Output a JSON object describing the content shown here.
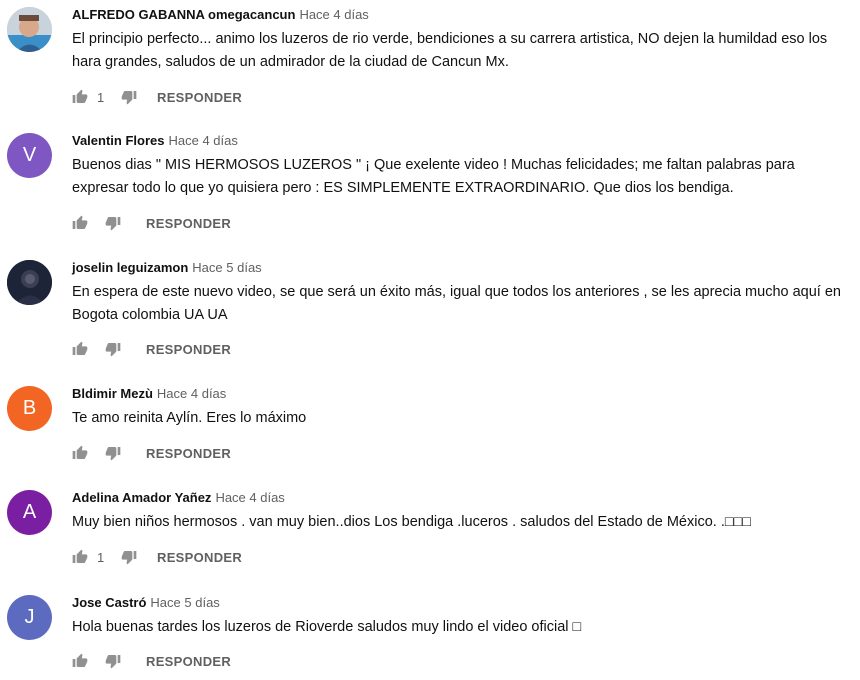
{
  "reply_label": "RESPONDER",
  "comments": [
    {
      "author": "ALFREDO GABANNA omegacancun",
      "time": "Hace 4 días",
      "text": "El principio perfecto... animo los luzeros de rio verde, bendiciones a su carrera artistica, NO dejen la humildad eso los hara grandes, saludos de un admirador de la ciudad de Cancun Mx.",
      "likes": "1",
      "avatar": {
        "type": "photo",
        "letter": ""
      }
    },
    {
      "author": "Valentin Flores",
      "time": "Hace 4 días",
      "text": "Buenos dias \" MIS HERMOSOS LUZEROS \"  ¡ Que exelente video ! Muchas felicidades; me faltan palabras para expresar todo lo que yo quisiera pero :  ES SIMPLEMENTE EXTRAORDINARIO.  Que dios los bendiga.",
      "likes": "",
      "avatar": {
        "type": "letter",
        "letter": "V",
        "color": "#7e57c2"
      }
    },
    {
      "author": "joselin leguizamon",
      "time": "Hace 5 días",
      "text": "En espera de este nuevo video, se que será un éxito más, igual que todos los anteriores , se les aprecia mucho aquí en Bogota colombia UA UA",
      "likes": "",
      "avatar": {
        "type": "photo-dark",
        "letter": ""
      }
    },
    {
      "author": "Bldimir Mezù",
      "time": "Hace 4 días",
      "text": "Te amo reinita Aylín. Eres lo máximo",
      "likes": "",
      "avatar": {
        "type": "letter",
        "letter": "B",
        "color": "#f26522"
      }
    },
    {
      "author": "Adelina Amador Yañez",
      "time": "Hace 4 días",
      "text": "Muy bien niños hermosos . van muy bien..dios Los bendiga .luceros . saludos del Estado de México. .□□□",
      "likes": "1",
      "avatar": {
        "type": "letter",
        "letter": "A",
        "color": "#7b1fa2"
      }
    },
    {
      "author": "Jose Castró",
      "time": "Hace 5 días",
      "text": "Hola buenas tardes los luzeros de Rioverde saludos muy lindo el video oficial □",
      "likes": "",
      "avatar": {
        "type": "letter",
        "letter": "J",
        "color": "#5c6bc0"
      }
    }
  ]
}
